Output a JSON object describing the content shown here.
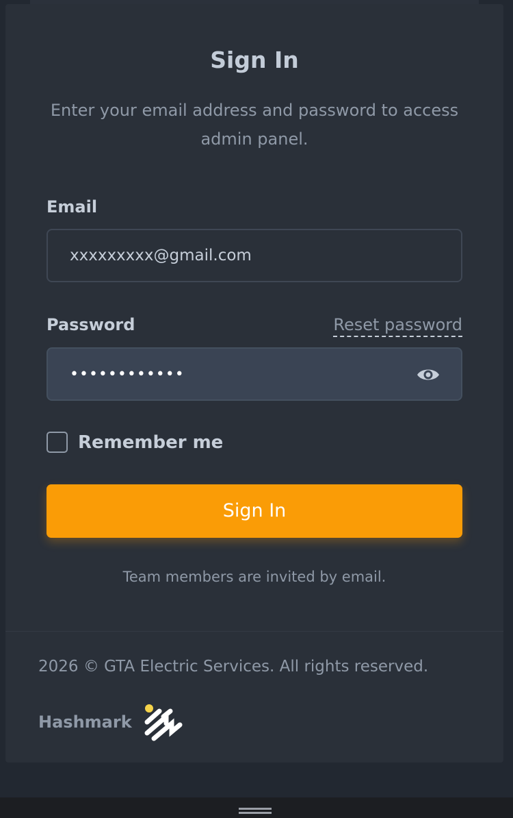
{
  "signin": {
    "title": "Sign In",
    "subtitle": "Enter your email address and password to access admin panel.",
    "email_label": "Email",
    "email_value": "xxxxxxxxx@gmail.com",
    "password_label": "Password",
    "reset_link": "Reset password",
    "password_value": "••••••••••••",
    "password_toggle_icon": "eye-icon",
    "remember_label": "Remember me",
    "remember_checked": false,
    "submit_label": "Sign In",
    "invite_note": "Team members are invited by email."
  },
  "footer": {
    "copyright": "2026 © GTA Electric Services. All rights reserved.",
    "brand_name": "Hashmark",
    "brand_logo_icon": "hashmark-logo-icon"
  },
  "colors": {
    "accent": "#fa9c06",
    "background": "#222831",
    "card": "#2a3039",
    "text": "#c6ced9",
    "muted": "#8f99a7"
  }
}
